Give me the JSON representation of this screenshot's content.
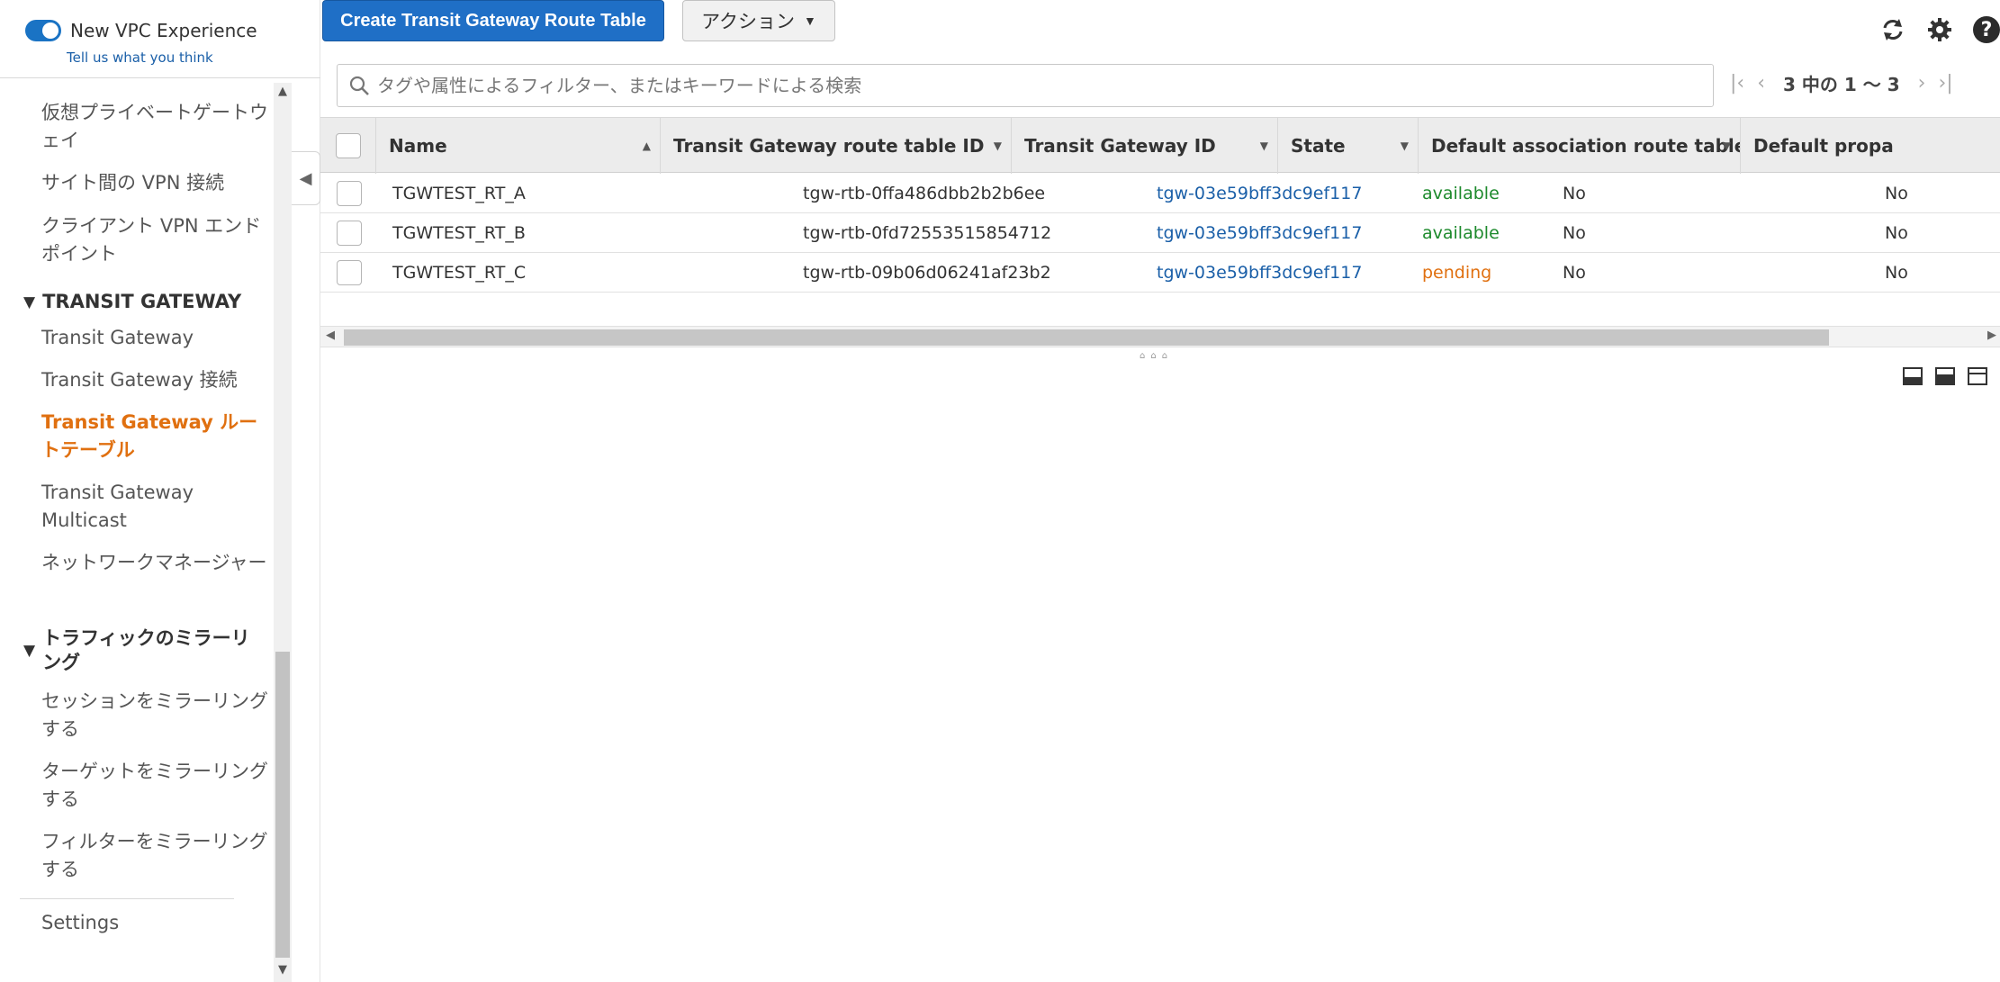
{
  "sidebar": {
    "vpc_toggle_label": "New VPC Experience",
    "feedback_link": "Tell us what you think",
    "items": [
      {
        "label": "仮想プライベートゲートウェイ"
      },
      {
        "label": "サイト間の VPN 接続"
      },
      {
        "label": "クライアント VPN エンドポイント"
      }
    ],
    "section_transit": "TRANSIT GATEWAY",
    "transit_items": [
      {
        "label": "Transit Gateway"
      },
      {
        "label": "Transit Gateway 接続"
      },
      {
        "label": "Transit Gateway ルートテーブル"
      },
      {
        "label": "Transit Gateway Multicast"
      },
      {
        "label": "ネットワークマネージャー"
      }
    ],
    "section_mirroring": "トラフィックのミラーリング",
    "mirroring_items": [
      {
        "label": "セッションをミラーリングする"
      },
      {
        "label": "ターゲットをミラーリングする"
      },
      {
        "label": "フィルターをミラーリングする"
      }
    ],
    "settings_label": "Settings"
  },
  "toolbar": {
    "create_label": "Create Transit Gateway Route Table",
    "actions_label": "アクション"
  },
  "search": {
    "placeholder": "タグや属性によるフィルター、またはキーワードによる検索"
  },
  "pager": {
    "text": "3 中の 1 ～ 3"
  },
  "table": {
    "columns": [
      "Name",
      "Transit Gateway route table ID",
      "Transit Gateway ID",
      "State",
      "Default association route table",
      "Default propa"
    ],
    "rows": [
      {
        "name": "TGWTEST_RT_A",
        "rtb_id": "tgw-rtb-0ffa486dbb2b2b6ee",
        "tgw_id": "tgw-03e59bff3dc9ef117",
        "state": "available",
        "assoc": "No",
        "prop": "No"
      },
      {
        "name": "TGWTEST_RT_B",
        "rtb_id": "tgw-rtb-0fd72553515854712",
        "tgw_id": "tgw-03e59bff3dc9ef117",
        "state": "available",
        "assoc": "No",
        "prop": "No"
      },
      {
        "name": "TGWTEST_RT_C",
        "rtb_id": "tgw-rtb-09b06d06241af23b2",
        "tgw_id": "tgw-03e59bff3dc9ef117",
        "state": "pending",
        "assoc": "No",
        "prop": "No"
      }
    ]
  },
  "colors": {
    "primary_button": "#1f6fc6",
    "active_nav": "#e07010",
    "state_available": "#1d8a2c",
    "state_pending": "#e07010",
    "link": "#1a5fa8"
  },
  "icons": {
    "refresh": "refresh-icon",
    "settings": "gear-icon",
    "help": "help-icon",
    "search": "search-icon"
  }
}
